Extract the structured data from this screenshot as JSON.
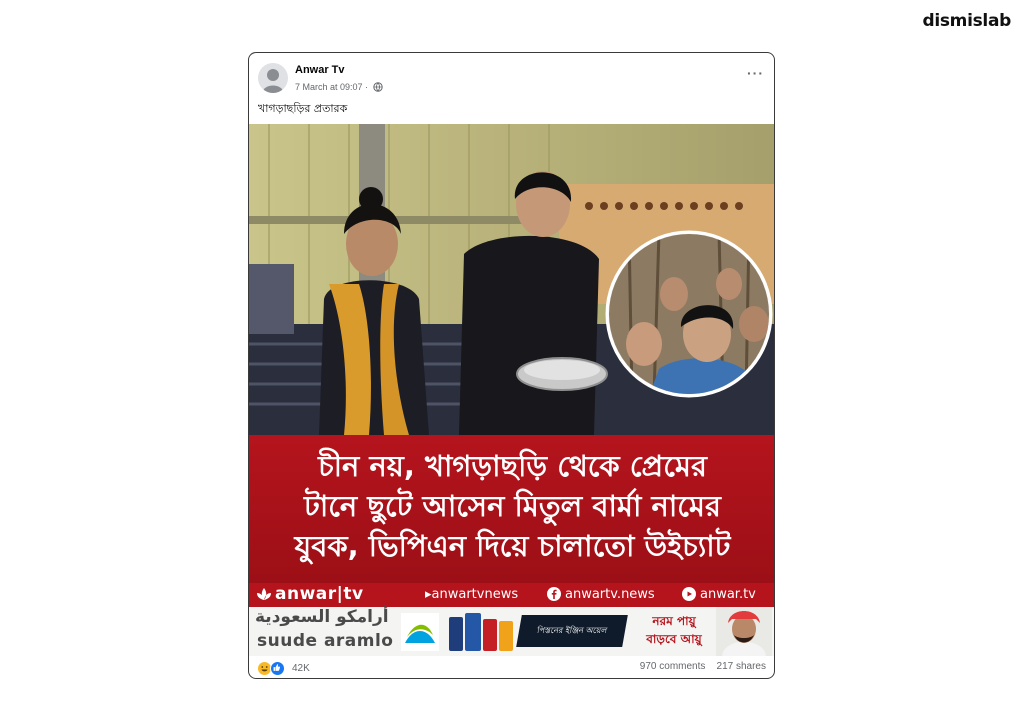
{
  "watermark": "dismislab",
  "post": {
    "author": "Anwar Tv",
    "timestamp": "7 March at 09:07 ·",
    "caption": "খাগড়াছড়ির প্রতারক",
    "more_label": "···",
    "media": {
      "headline_lines": [
        "চীন নয়, খাগড়াছড়ি থেকে প্রেমের",
        "টানে ছুটে আসেন মিতুল বার্মা নামের",
        "যুবক, ভিপিএন দিয়ে চালাতো উইচ্যাট"
      ],
      "brand": {
        "logo": "anwar|tv",
        "handle_1": "▸anwartvnews",
        "handle_2": "anwartv.news",
        "handle_3": "anwar.tv"
      },
      "ad": {
        "arabic": "أرامكو السعودية",
        "latin": "suude aramlo",
        "strip_text": "পিস্তনের ইঞ্জিন অয়েল",
        "slogan_1": "নরম পায়ু",
        "slogan_2": "বাড়বে আয়ু"
      }
    },
    "reactions": {
      "count": "42K",
      "icons": [
        "haha-icon",
        "like-icon"
      ]
    },
    "comments": "970 comments",
    "shares": "217 shares"
  },
  "colors": {
    "banner_red": "#b5141d",
    "meta_gray": "#65676b",
    "like_blue": "#1877f2",
    "haha_yellow": "#f7b928"
  }
}
